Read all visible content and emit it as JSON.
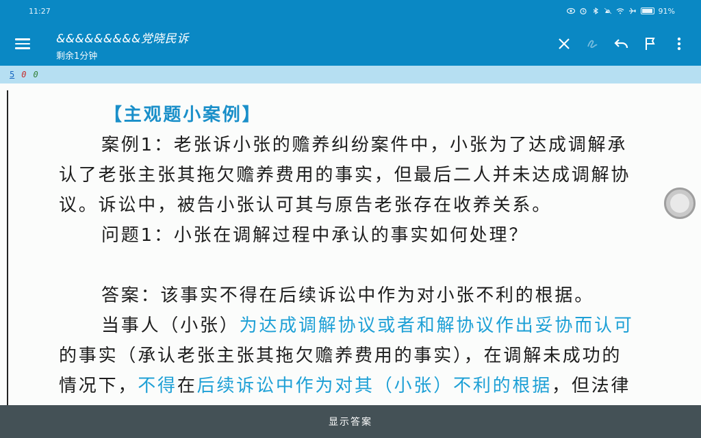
{
  "status": {
    "time": "11:27",
    "battery": "91%",
    "battery_level": 0.91,
    "icons": [
      "eye-icon",
      "alarm-icon",
      "bluetooth-icon",
      "mute-icon",
      "wifi-icon",
      "airplane-icon",
      "battery-icon"
    ]
  },
  "appbar": {
    "title": "&&&&&&&&&党晓民诉",
    "subtitle": "剩余1分钟",
    "icons": [
      "menu-icon",
      "close-icon",
      "handwriting-icon",
      "undo-icon",
      "flag-icon",
      "more-vert-icon"
    ]
  },
  "indicators": [
    "5",
    "0",
    "0"
  ],
  "passage": {
    "heading": "【主观题小案例】",
    "line1": "案例1：老张诉小张的赡养纠纷案件中，小张为了达成调解承",
    "line2": "认了老张主张其拖欠赡养费用的事实，但最后二人并未达成调解协",
    "line3": "议。诉讼中，被告小张认可其与原告老张存在收养关系。",
    "line4": "问题1：小张在调解过程中承认的事实如何处理？",
    "line5": "答案：该事实不得在后续诉讼中作为对小张不利的根据。",
    "line6_a": "当事人（小张）",
    "line6_b": "为达成调解协议或者和解协议作出妥协而认可",
    "line7": "的事实（承认老张主张其拖欠赡养费用的事实），在调解未成功的",
    "line8_a": "情况下，",
    "line8_b": "不得",
    "line8_c": "在",
    "line8_d": "后续诉讼中作为对其（小张）不利的根据",
    "line8_e": "，但法律"
  },
  "bottom": {
    "show_answer": "显示答案"
  },
  "colors": {
    "primary": "#0a88c4",
    "secondary_bar": "#b6dff2",
    "highlight": "#1ea0d6",
    "bottom_bar": "#445156"
  }
}
